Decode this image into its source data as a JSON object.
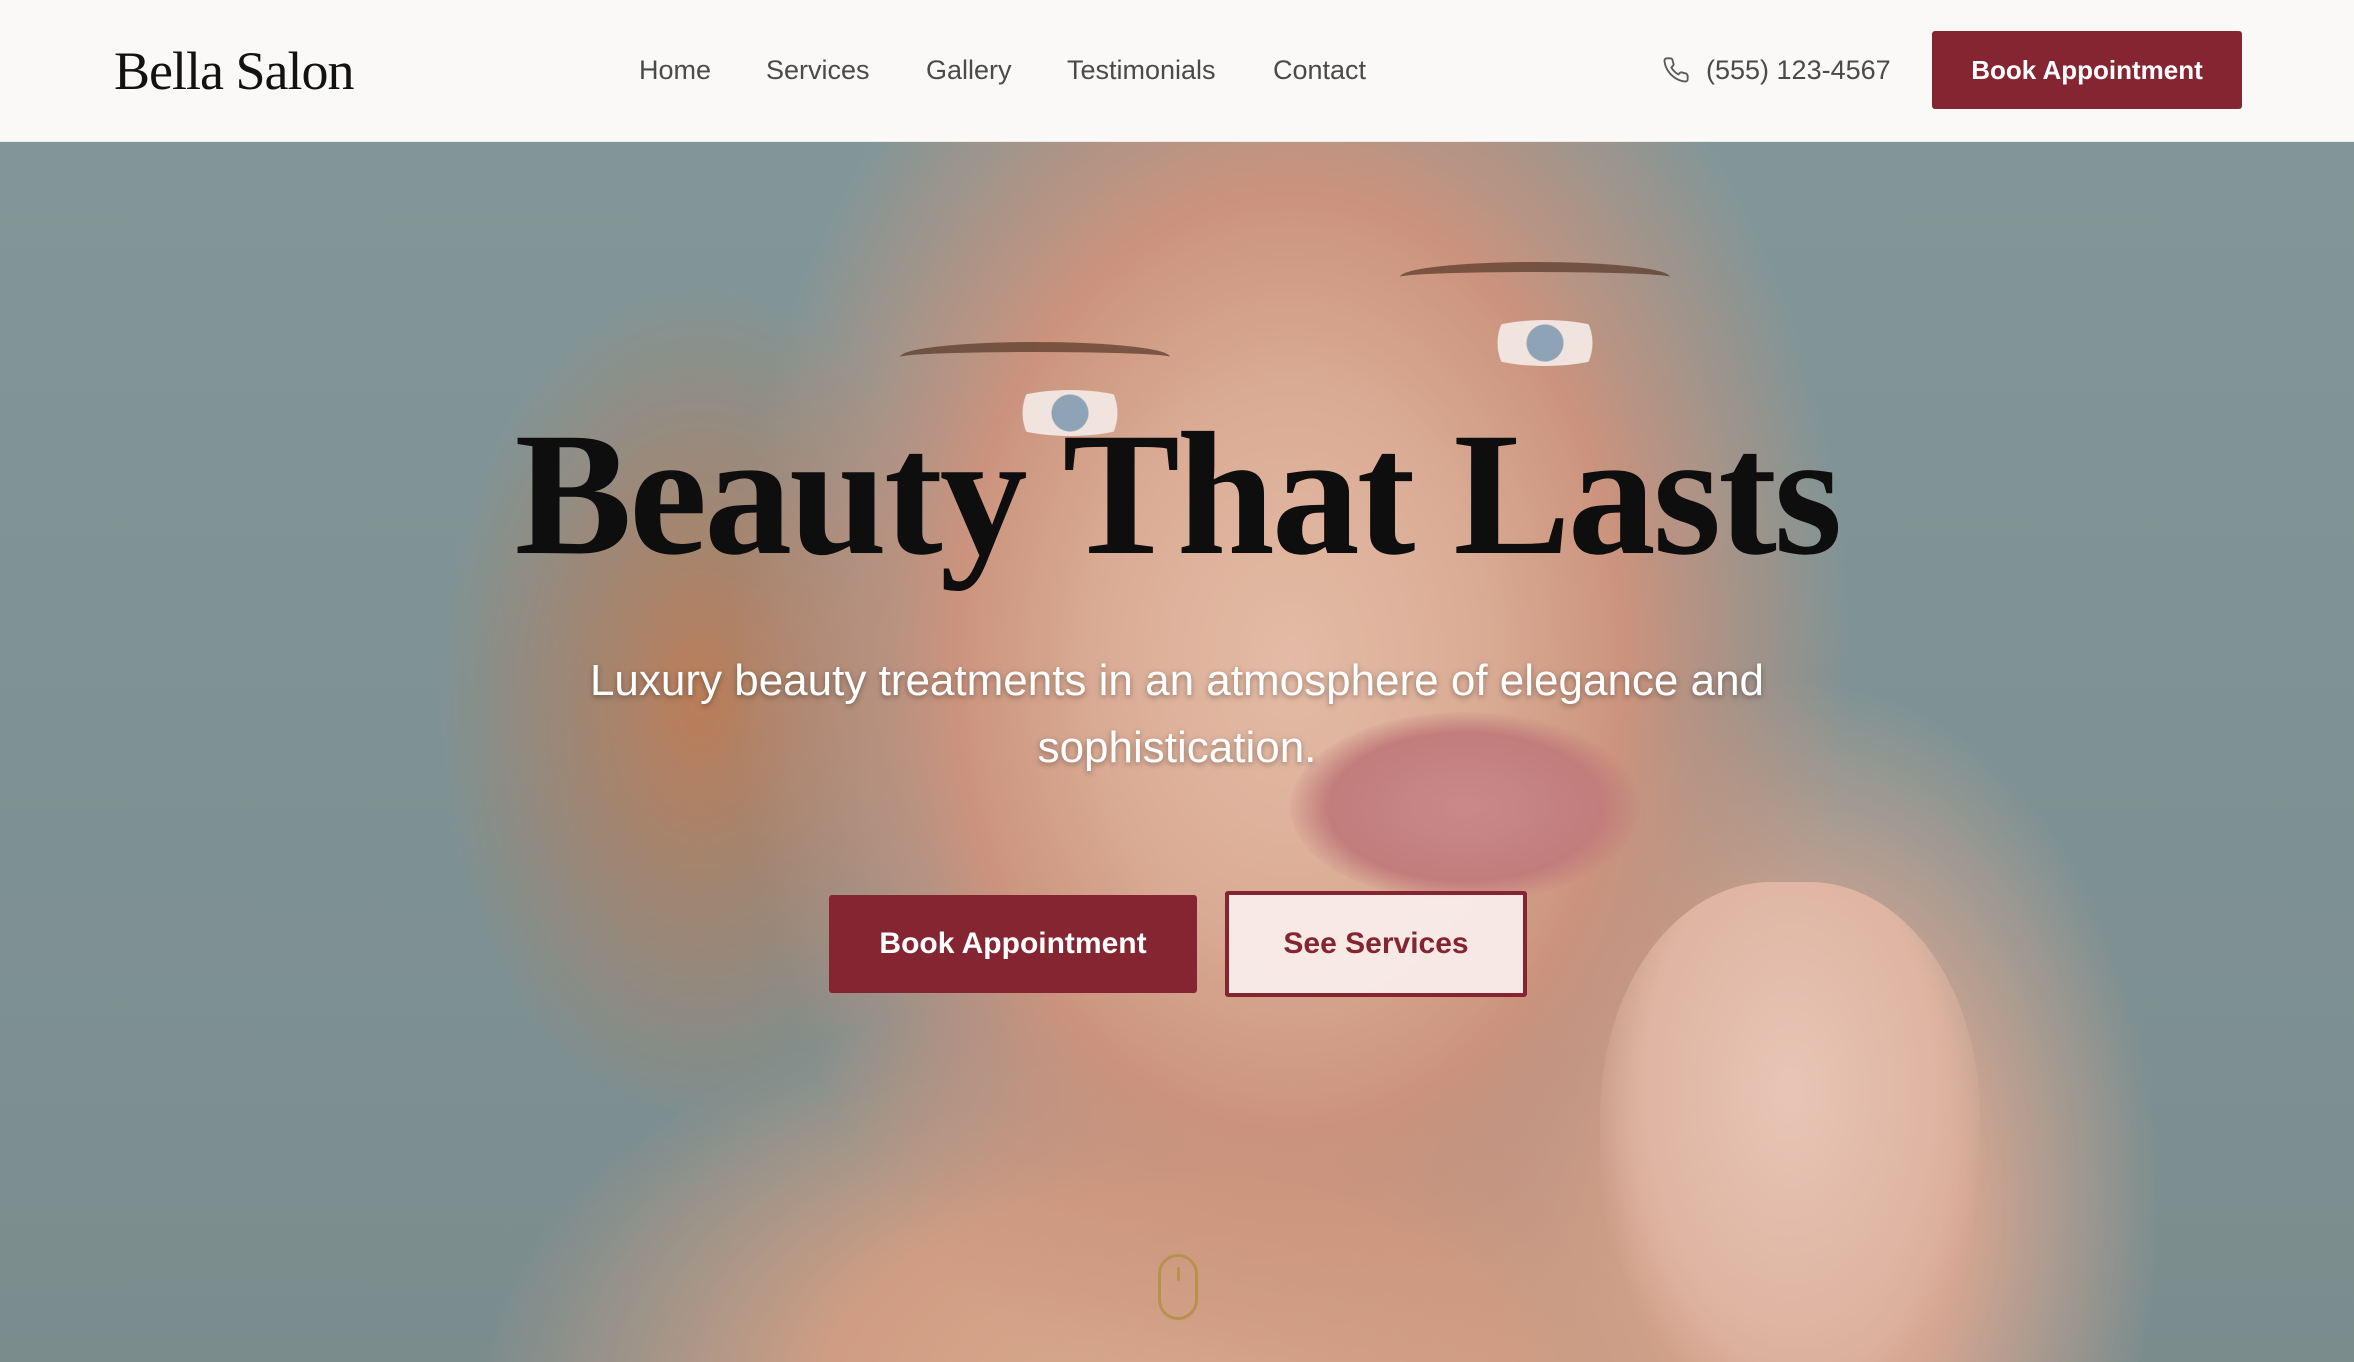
{
  "brand": {
    "name": "Bella Salon"
  },
  "nav": {
    "items": [
      {
        "label": "Home"
      },
      {
        "label": "Services"
      },
      {
        "label": "Gallery"
      },
      {
        "label": "Testimonials"
      },
      {
        "label": "Contact"
      }
    ]
  },
  "contact": {
    "phone": "(555) 123-4567",
    "icon": "phone-icon"
  },
  "header": {
    "cta_label": "Book Appointment"
  },
  "hero": {
    "title": "Beauty That Lasts",
    "subtitle": "Luxury beauty treatments in an atmosphere of elegance and sophistication.",
    "primary_cta": "Book Appointment",
    "secondary_cta": "See Services",
    "scroll_icon": "mouse-scroll-icon"
  },
  "colors": {
    "accent": "#842531",
    "header_bg": "#faf9f8",
    "nav_text": "#4a4a4a",
    "title_text": "#0e0e0e",
    "scroll_icon": "#b8924a"
  }
}
